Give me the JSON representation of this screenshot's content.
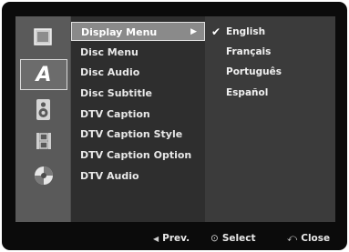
{
  "tabs": [
    {
      "icon": "display-icon",
      "label": ""
    },
    {
      "icon": "language-letter-icon",
      "label": "A"
    },
    {
      "icon": "speaker-icon",
      "label": ""
    },
    {
      "icon": "film-strip-icon",
      "label": ""
    },
    {
      "icon": "disc-icon",
      "label": ""
    }
  ],
  "menu": {
    "items": [
      {
        "label": "Display Menu",
        "selected": true
      },
      {
        "label": "Disc Menu"
      },
      {
        "label": "Disc Audio"
      },
      {
        "label": "Disc Subtitle"
      },
      {
        "label": "DTV Caption"
      },
      {
        "label": "DTV Caption Style"
      },
      {
        "label": "DTV Caption Option"
      },
      {
        "label": "DTV Audio"
      }
    ],
    "arrow": "▶"
  },
  "options": {
    "items": [
      {
        "label": "English",
        "checked": true
      },
      {
        "label": "Français"
      },
      {
        "label": "Português"
      },
      {
        "label": "Español"
      }
    ],
    "check_mark": "✔"
  },
  "footer": {
    "prev_icon": "◀",
    "prev_label": "Prev.",
    "select_icon": "⊙",
    "select_label": "Select",
    "close_icon": "⤺",
    "close_label": "Close"
  }
}
